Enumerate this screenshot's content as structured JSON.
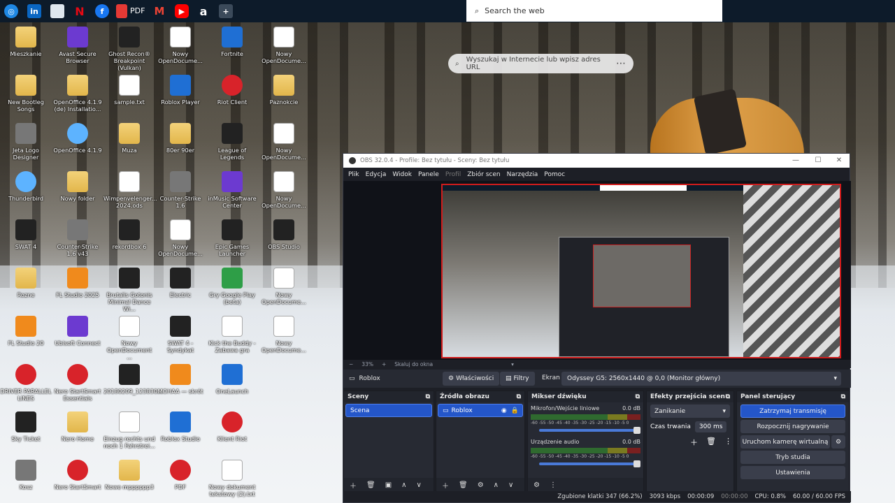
{
  "taskbar": {
    "pdf_label": "PDF",
    "search_text": "Search the web"
  },
  "browser_search_placeholder": "Wyszukaj w Internecie lub wpisz adres URL",
  "desktop_icons": [
    {
      "label": "Mieszkanie",
      "icon": "folder"
    },
    {
      "label": "Avast Secure Browser",
      "icon": "purple"
    },
    {
      "label": "Ghost Recon® Breakpoint (Vulkan)",
      "icon": "dark"
    },
    {
      "label": "Nowy OpenDocume...",
      "icon": "doc"
    },
    {
      "label": "Fortnite",
      "icon": "blue"
    },
    {
      "label": "Nowy OpenDocume...",
      "icon": "doc"
    },
    {
      "label": "New Bootleg Songs",
      "icon": "folder"
    },
    {
      "label": "OpenOffice 4.1.9 (de) Installatio...",
      "icon": "folder"
    },
    {
      "label": "sample.txt",
      "icon": "doc"
    },
    {
      "label": "Roblox Player",
      "icon": "blue"
    },
    {
      "label": "Riot Client",
      "icon": "red"
    },
    {
      "label": "Paznokcie",
      "icon": "folder"
    },
    {
      "label": "Jeta Logo Designer",
      "icon": "gray"
    },
    {
      "label": "OpenOffice 4.1.9",
      "icon": "sky"
    },
    {
      "label": "Muza",
      "icon": "folder"
    },
    {
      "label": "80er 90er",
      "icon": "folder"
    },
    {
      "label": "League of Legends",
      "icon": "dark"
    },
    {
      "label": "Nowy OpenDocume...",
      "icon": "doc"
    },
    {
      "label": "Thunderbird",
      "icon": "sky"
    },
    {
      "label": "Nowy folder",
      "icon": "folder"
    },
    {
      "label": "Wimpenvelenger... 2024.ods",
      "icon": "doc"
    },
    {
      "label": "Counter-Strike 1.6",
      "icon": "gray"
    },
    {
      "label": "inMusic Software Center",
      "icon": "purple"
    },
    {
      "label": "Nowy OpenDocume...",
      "icon": "doc"
    },
    {
      "label": "SWAT 4",
      "icon": "dark"
    },
    {
      "label": "Counter-Strike 1.6 v43",
      "icon": "gray"
    },
    {
      "label": "rekordbox 6",
      "icon": "dark"
    },
    {
      "label": "Nowy OpenDocume...",
      "icon": "doc"
    },
    {
      "label": "Epic Games Launcher",
      "icon": "dark"
    },
    {
      "label": "OBS Studio",
      "icon": "dark"
    },
    {
      "label": "Rozne",
      "icon": "folder"
    },
    {
      "label": "FL Studio 2025",
      "icon": "orange"
    },
    {
      "label": "Brutalis Gotonis Minimal Dance Wi...",
      "icon": "dark"
    },
    {
      "label": "Electric",
      "icon": "dark"
    },
    {
      "label": "Gry Google Play (beta)",
      "icon": "green"
    },
    {
      "label": "Nowy OpenDocume...",
      "icon": "doc"
    },
    {
      "label": "FL Studio 20",
      "icon": "orange"
    },
    {
      "label": "Ubisoft Connect",
      "icon": "purple"
    },
    {
      "label": "Nowy OpenDocument ...",
      "icon": "doc"
    },
    {
      "label": "SWAT 4 - Syndykat",
      "icon": "dark"
    },
    {
      "label": "Kick the Buddy - Zabawa gra",
      "icon": "doc"
    },
    {
      "label": "Nowy OpenDocume...",
      "icon": "doc"
    },
    {
      "label": "DRIVER PARALLEL LINES",
      "icon": "red"
    },
    {
      "label": "Nero StartSmart Essentials",
      "icon": "red"
    },
    {
      "label": "20180209_123830...",
      "icon": "dark"
    },
    {
      "label": "MOHAA — skrót",
      "icon": "orange"
    },
    {
      "label": "OneLaunch",
      "icon": "blue"
    },
    {
      "label": "",
      "icon": "none"
    },
    {
      "label": "Sky Ticket",
      "icon": "dark"
    },
    {
      "label": "Nero Home",
      "icon": "folder"
    },
    {
      "label": "Einzug rechts und noch 1 Fahrstrei...",
      "icon": "doc"
    },
    {
      "label": "Roblox Studio",
      "icon": "blue"
    },
    {
      "label": "Klient Riot",
      "icon": "red"
    },
    {
      "label": "",
      "icon": "none"
    },
    {
      "label": "Kosz",
      "icon": "gray"
    },
    {
      "label": "Nero StartSmart",
      "icon": "red"
    },
    {
      "label": "Nowe mpppppp3",
      "icon": "folder"
    },
    {
      "label": "PDF",
      "icon": "red"
    },
    {
      "label": "Nowy dokument tekstowy (2).txt",
      "icon": "doc"
    }
  ],
  "obs": {
    "title": "OBS 32.0.4 - Profile: Bez tytułu - Sceny: Bez tytułu",
    "menu": [
      "Plik",
      "Edycja",
      "Widok",
      "Panele",
      "Profil",
      "Zbiór scen",
      "Narzędzia",
      "Pomoc"
    ],
    "zoom": {
      "minus": "−",
      "value": "33%",
      "plus": "+",
      "fit": "Skaluj do okna"
    },
    "source_bar": {
      "selected_source": "Roblox",
      "properties": "Właściwości",
      "filters": "Filtry",
      "screen_label": "Ekran",
      "monitor": "Odyssey G5: 2560x1440 @ 0,0 (Monitor główny)"
    },
    "scenes": {
      "title": "Sceny",
      "items": [
        "Scena"
      ]
    },
    "sources": {
      "title": "Źródła obrazu",
      "items": [
        "Roblox"
      ]
    },
    "mixer": {
      "title": "Mikser dźwięku",
      "channels": [
        {
          "name": "Mikrofon/Wejście liniowe",
          "db": "0.0 dB"
        },
        {
          "name": "Urządzenie audio",
          "db": "0.0 dB"
        }
      ],
      "scale": "-60 -55 -50 -45 -40 -35 -30 -25 -20 -15 -10 -5 0"
    },
    "transitions": {
      "title": "Efekty przejścia scen",
      "selected": "Zanikanie",
      "duration_label": "Czas trwania",
      "duration_value": "300 ms"
    },
    "controls": {
      "title": "Panel sterujący",
      "buttons": [
        "Zatrzymaj transmisję",
        "Rozpocznij nagrywanie",
        "Uruchom kamerę wirtualną",
        "Tryb studia",
        "Ustawienia"
      ]
    },
    "status": {
      "dropped": "Zgubione klatki 347 (66.2%)",
      "bitrate": "3093 kbps",
      "stream_time": "00:00:09",
      "rec_time": "00:00:00",
      "cpu": "CPU: 0.8%",
      "fps": "60.00 / 60.00 FPS"
    }
  },
  "colors": {
    "accent": "#2456c9",
    "recording": "#d01c1c",
    "taskbar": "#0d1b2a"
  }
}
